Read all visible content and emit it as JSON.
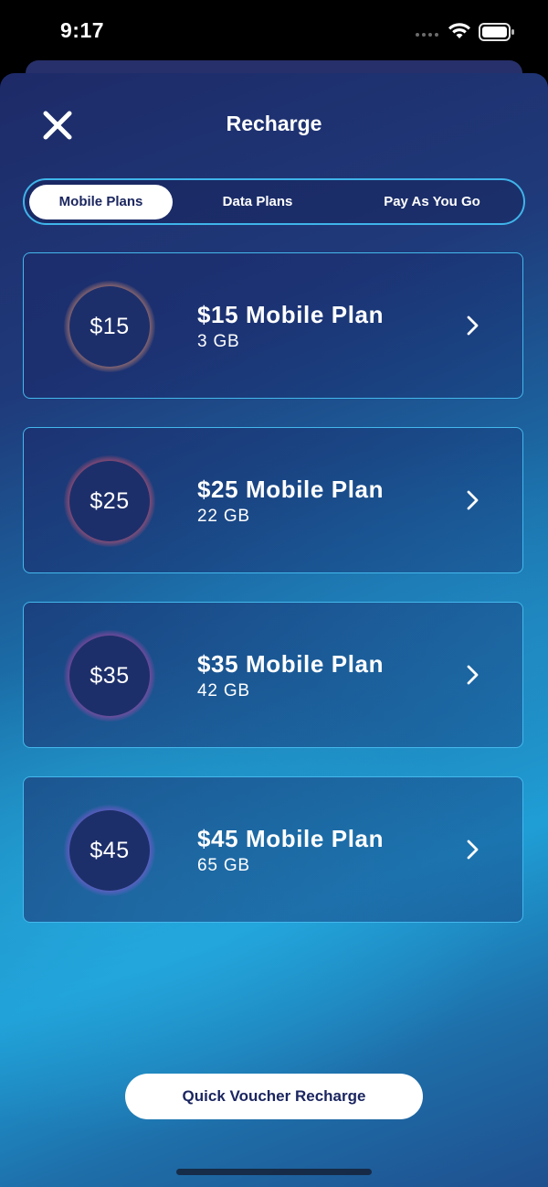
{
  "status_bar": {
    "time": "9:17",
    "icons": [
      "signal-icon",
      "wifi-icon",
      "battery-icon"
    ]
  },
  "header": {
    "title": "Recharge",
    "close_icon": "close-icon"
  },
  "tabs": [
    {
      "label": "Mobile Plans",
      "active": true
    },
    {
      "label": "Data Plans",
      "active": false
    },
    {
      "label": "Pay As You Go",
      "active": false
    }
  ],
  "plans": [
    {
      "price": "$15",
      "name": "$15 Mobile Plan",
      "data": "3 GB",
      "ring_color": "#ff8a5c"
    },
    {
      "price": "$25",
      "name": "$25 Mobile Plan",
      "data": "22 GB",
      "ring_color": "#ff3d55"
    },
    {
      "price": "$35",
      "name": "$35 Mobile Plan",
      "data": "42 GB",
      "ring_color": "#c62aa0"
    },
    {
      "price": "$45",
      "name": "$45 Mobile Plan",
      "data": "65 GB",
      "ring_color": "#8a3fd8"
    }
  ],
  "footer": {
    "voucher_label": "Quick Voucher Recharge"
  },
  "colors": {
    "accent_border": "#44b8ec",
    "navy": "#1b2660",
    "background_top": "#1e2a68",
    "background_mid": "#1f9fd6"
  }
}
